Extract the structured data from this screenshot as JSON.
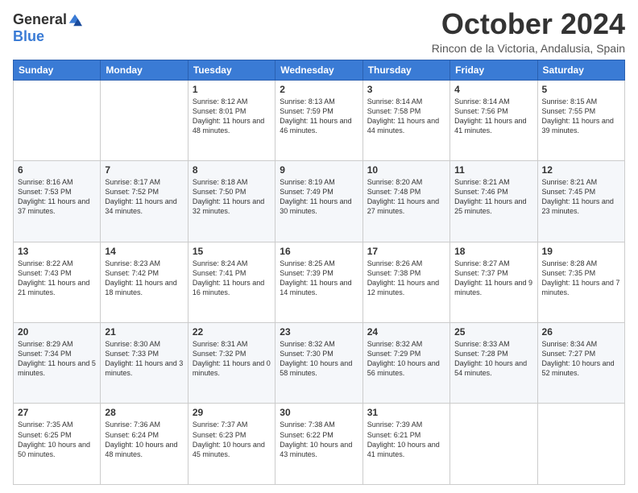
{
  "header": {
    "logo_general": "General",
    "logo_blue": "Blue",
    "month_title": "October 2024",
    "location": "Rincon de la Victoria, Andalusia, Spain"
  },
  "days_of_week": [
    "Sunday",
    "Monday",
    "Tuesday",
    "Wednesday",
    "Thursday",
    "Friday",
    "Saturday"
  ],
  "weeks": [
    [
      {
        "day": "",
        "info": ""
      },
      {
        "day": "",
        "info": ""
      },
      {
        "day": "1",
        "info": "Sunrise: 8:12 AM\nSunset: 8:01 PM\nDaylight: 11 hours and 48 minutes."
      },
      {
        "day": "2",
        "info": "Sunrise: 8:13 AM\nSunset: 7:59 PM\nDaylight: 11 hours and 46 minutes."
      },
      {
        "day": "3",
        "info": "Sunrise: 8:14 AM\nSunset: 7:58 PM\nDaylight: 11 hours and 44 minutes."
      },
      {
        "day": "4",
        "info": "Sunrise: 8:14 AM\nSunset: 7:56 PM\nDaylight: 11 hours and 41 minutes."
      },
      {
        "day": "5",
        "info": "Sunrise: 8:15 AM\nSunset: 7:55 PM\nDaylight: 11 hours and 39 minutes."
      }
    ],
    [
      {
        "day": "6",
        "info": "Sunrise: 8:16 AM\nSunset: 7:53 PM\nDaylight: 11 hours and 37 minutes."
      },
      {
        "day": "7",
        "info": "Sunrise: 8:17 AM\nSunset: 7:52 PM\nDaylight: 11 hours and 34 minutes."
      },
      {
        "day": "8",
        "info": "Sunrise: 8:18 AM\nSunset: 7:50 PM\nDaylight: 11 hours and 32 minutes."
      },
      {
        "day": "9",
        "info": "Sunrise: 8:19 AM\nSunset: 7:49 PM\nDaylight: 11 hours and 30 minutes."
      },
      {
        "day": "10",
        "info": "Sunrise: 8:20 AM\nSunset: 7:48 PM\nDaylight: 11 hours and 27 minutes."
      },
      {
        "day": "11",
        "info": "Sunrise: 8:21 AM\nSunset: 7:46 PM\nDaylight: 11 hours and 25 minutes."
      },
      {
        "day": "12",
        "info": "Sunrise: 8:21 AM\nSunset: 7:45 PM\nDaylight: 11 hours and 23 minutes."
      }
    ],
    [
      {
        "day": "13",
        "info": "Sunrise: 8:22 AM\nSunset: 7:43 PM\nDaylight: 11 hours and 21 minutes."
      },
      {
        "day": "14",
        "info": "Sunrise: 8:23 AM\nSunset: 7:42 PM\nDaylight: 11 hours and 18 minutes."
      },
      {
        "day": "15",
        "info": "Sunrise: 8:24 AM\nSunset: 7:41 PM\nDaylight: 11 hours and 16 minutes."
      },
      {
        "day": "16",
        "info": "Sunrise: 8:25 AM\nSunset: 7:39 PM\nDaylight: 11 hours and 14 minutes."
      },
      {
        "day": "17",
        "info": "Sunrise: 8:26 AM\nSunset: 7:38 PM\nDaylight: 11 hours and 12 minutes."
      },
      {
        "day": "18",
        "info": "Sunrise: 8:27 AM\nSunset: 7:37 PM\nDaylight: 11 hours and 9 minutes."
      },
      {
        "day": "19",
        "info": "Sunrise: 8:28 AM\nSunset: 7:35 PM\nDaylight: 11 hours and 7 minutes."
      }
    ],
    [
      {
        "day": "20",
        "info": "Sunrise: 8:29 AM\nSunset: 7:34 PM\nDaylight: 11 hours and 5 minutes."
      },
      {
        "day": "21",
        "info": "Sunrise: 8:30 AM\nSunset: 7:33 PM\nDaylight: 11 hours and 3 minutes."
      },
      {
        "day": "22",
        "info": "Sunrise: 8:31 AM\nSunset: 7:32 PM\nDaylight: 11 hours and 0 minutes."
      },
      {
        "day": "23",
        "info": "Sunrise: 8:32 AM\nSunset: 7:30 PM\nDaylight: 10 hours and 58 minutes."
      },
      {
        "day": "24",
        "info": "Sunrise: 8:32 AM\nSunset: 7:29 PM\nDaylight: 10 hours and 56 minutes."
      },
      {
        "day": "25",
        "info": "Sunrise: 8:33 AM\nSunset: 7:28 PM\nDaylight: 10 hours and 54 minutes."
      },
      {
        "day": "26",
        "info": "Sunrise: 8:34 AM\nSunset: 7:27 PM\nDaylight: 10 hours and 52 minutes."
      }
    ],
    [
      {
        "day": "27",
        "info": "Sunrise: 7:35 AM\nSunset: 6:25 PM\nDaylight: 10 hours and 50 minutes."
      },
      {
        "day": "28",
        "info": "Sunrise: 7:36 AM\nSunset: 6:24 PM\nDaylight: 10 hours and 48 minutes."
      },
      {
        "day": "29",
        "info": "Sunrise: 7:37 AM\nSunset: 6:23 PM\nDaylight: 10 hours and 45 minutes."
      },
      {
        "day": "30",
        "info": "Sunrise: 7:38 AM\nSunset: 6:22 PM\nDaylight: 10 hours and 43 minutes."
      },
      {
        "day": "31",
        "info": "Sunrise: 7:39 AM\nSunset: 6:21 PM\nDaylight: 10 hours and 41 minutes."
      },
      {
        "day": "",
        "info": ""
      },
      {
        "day": "",
        "info": ""
      }
    ]
  ]
}
